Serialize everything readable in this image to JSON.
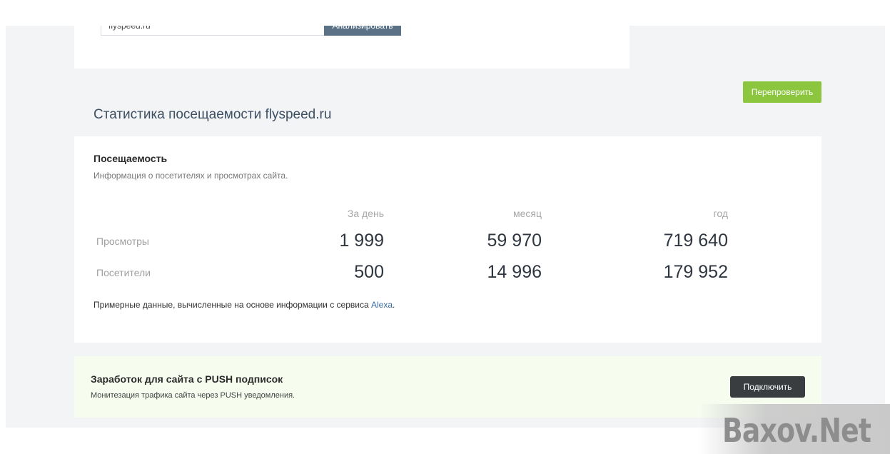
{
  "search": {
    "input_value": "flyspeed.ru",
    "analyze_label": "Анализировать"
  },
  "recheck_label": "Перепроверить",
  "section_title": "Статистика посещаемости flyspeed.ru",
  "stats": {
    "heading": "Посещаемость",
    "subheading": "Информация о посетителях и просмотрах сайта.",
    "columns": [
      "За день",
      "месяц",
      "год"
    ],
    "rows": [
      {
        "label": "Просмотры",
        "values": [
          "1 999",
          "59 970",
          "719 640"
        ]
      },
      {
        "label": "Посетители",
        "values": [
          "500",
          "14 996",
          "179 952"
        ]
      }
    ],
    "note_prefix": "Примерные данные, вычисленные на основе информации с сервиса ",
    "note_link": "Alexa",
    "note_suffix": "."
  },
  "push": {
    "title": "Заработок для сайта с PUSH подписок",
    "subtitle": "Монитезация трафика сайта через PUSH уведомления.",
    "button_label": "Подключить"
  },
  "watermark": "Baxov.Net",
  "colors": {
    "accent_green": "#8cc63f",
    "dark_button": "#3a3d40",
    "analyze_button": "#5b7286",
    "link": "#3a6ea5"
  }
}
